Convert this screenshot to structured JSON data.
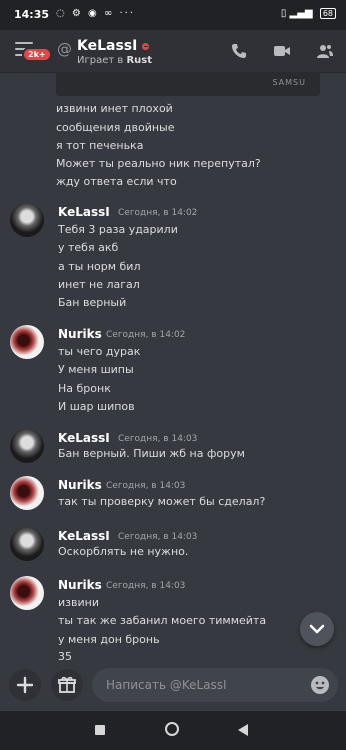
{
  "status_bar": {
    "time": "14:35",
    "battery": "68"
  },
  "header": {
    "badge": "2k+",
    "user_name": "KeLassI",
    "activity_prefix": "Играет в",
    "activity_game": "Rust"
  },
  "attachment_label": "SAMSU",
  "continuation_lines": [
    "извини инет плохой",
    "сообщения двойные",
    "я тот печенька",
    "Может ты реально ник перепутал?",
    "жду ответа если что"
  ],
  "groups": [
    {
      "author": "KeLassI",
      "time": "Сегодня, в 14:02",
      "lines": [
        "Тебя  3 раза ударили",
        "у тебя акб",
        "а ты норм бил",
        "инет не лагал",
        "Бан верный"
      ]
    },
    {
      "author": "Nuriks",
      "time": "Сегодня, в 14:02",
      "lines": [
        "ты чего дурак",
        "У меня шипы",
        "На бронк",
        "И шар шипов"
      ]
    },
    {
      "author": "KeLassI",
      "time": "Сегодня, в 14:03",
      "lines": [
        "Бан верный. Пиши жб на форум"
      ]
    },
    {
      "author": "Nuriks",
      "time": "Сегодня, в 14:03",
      "lines": [
        "так ты проверку может бы сделал?"
      ]
    },
    {
      "author": "KeLassI",
      "time": "Сегодня, в 14:03",
      "lines": [
        "Оскорблять не нужно."
      ]
    },
    {
      "author": "Nuriks",
      "time": "Сегодня, в 14:03",
      "lines": [
        "извини",
        "ты так же забанил моего тиммейта",
        "у меня дон бронь",
        "35"
      ]
    }
  ],
  "composer": {
    "placeholder": "Написать @KeLassI"
  },
  "colors": {
    "background": "#36393f",
    "header": "#2f3136",
    "dnd": "#ed4245"
  }
}
